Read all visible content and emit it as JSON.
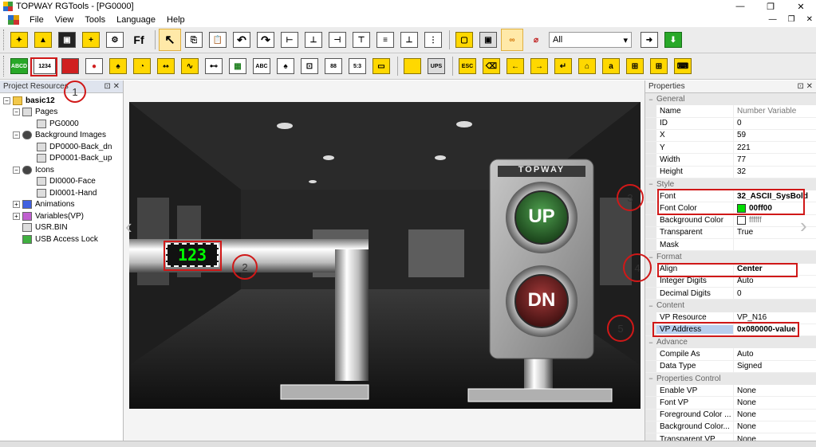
{
  "window": {
    "title": "TOPWAY RGTools - [PG0000]",
    "controls": [
      "—",
      "❐",
      "✕"
    ]
  },
  "menu": {
    "items": [
      "File",
      "View",
      "Tools",
      "Language",
      "Help"
    ],
    "mdi_controls": [
      "—",
      "❐",
      "✕"
    ]
  },
  "toolbar": {
    "layer_combo": "All",
    "icon_1234": "1234",
    "icon_abcd": "ABCD",
    "icon_ff": "Ff",
    "icon_abc": "ABC",
    "icon_esc": "ESC",
    "icon_a": "a",
    "icon_ups": "UPS"
  },
  "project_panel": {
    "title": "Project Resources",
    "tree": [
      {
        "label": "basic12",
        "level": 0
      },
      {
        "label": "Pages",
        "level": 1
      },
      {
        "label": "PG0000",
        "level": 2
      },
      {
        "label": "Background Images",
        "level": 1
      },
      {
        "label": "DP0000-Back_dn",
        "level": 2
      },
      {
        "label": "DP0001-Back_up",
        "level": 2
      },
      {
        "label": "Icons",
        "level": 1
      },
      {
        "label": "DI0000-Face",
        "level": 2
      },
      {
        "label": "DI0001-Hand",
        "level": 2
      },
      {
        "label": "Animations",
        "level": 1
      },
      {
        "label": "Variables(VP)",
        "level": 1
      },
      {
        "label": "USR.BIN",
        "level": 1
      },
      {
        "label": "USB Access Lock",
        "level": 1
      }
    ]
  },
  "canvas": {
    "number_widget": "123",
    "brand": "TOPWAY",
    "up_label": "UP",
    "dn_label": "DN"
  },
  "properties": {
    "title": "Properties",
    "rows": [
      {
        "type": "cat",
        "name": "General"
      },
      {
        "type": "row",
        "name": "Name",
        "value": "Number Variable",
        "muted": true
      },
      {
        "type": "row",
        "name": "ID",
        "value": "0"
      },
      {
        "type": "row",
        "name": "X",
        "value": "59"
      },
      {
        "type": "row",
        "name": "Y",
        "value": "221"
      },
      {
        "type": "row",
        "name": "Width",
        "value": "77"
      },
      {
        "type": "row",
        "name": "Height",
        "value": "32"
      },
      {
        "type": "cat",
        "name": "Style"
      },
      {
        "type": "row",
        "name": "Font",
        "value": "32_ASCII_SysBold",
        "bold": true
      },
      {
        "type": "row",
        "name": "Font Color",
        "value": "00ff00",
        "bold": true,
        "swatch": "#00dd00"
      },
      {
        "type": "row",
        "name": "Background Color",
        "value": "ffffff",
        "muted": true,
        "swatch": "#ffffff"
      },
      {
        "type": "row",
        "name": "Transparent",
        "value": "True"
      },
      {
        "type": "row",
        "name": "Mask",
        "value": ""
      },
      {
        "type": "cat",
        "name": "Format"
      },
      {
        "type": "row",
        "name": "Align",
        "value": "Center",
        "bold": true
      },
      {
        "type": "row",
        "name": "Integer Digits",
        "value": "Auto"
      },
      {
        "type": "row",
        "name": "Decimal Digits",
        "value": "0"
      },
      {
        "type": "cat",
        "name": "Content"
      },
      {
        "type": "row",
        "name": "VP Resource",
        "value": "VP_N16"
      },
      {
        "type": "row",
        "name": "VP Address",
        "value": "0x080000-value",
        "bold": true,
        "selected": true
      },
      {
        "type": "cat",
        "name": "Advance"
      },
      {
        "type": "row",
        "name": "Compile As",
        "value": "Auto"
      },
      {
        "type": "row",
        "name": "Data Type",
        "value": "Signed"
      },
      {
        "type": "cat",
        "name": "Properties Control"
      },
      {
        "type": "row",
        "name": "Enable VP",
        "value": "None"
      },
      {
        "type": "row",
        "name": "Font VP",
        "value": "None"
      },
      {
        "type": "row",
        "name": "Foreground Color ...",
        "value": "None"
      },
      {
        "type": "row",
        "name": "Background Color...",
        "value": "None"
      },
      {
        "type": "row",
        "name": "Transparent VP",
        "value": "None"
      }
    ]
  },
  "annotations": [
    "1",
    "2",
    "3",
    "4",
    "5"
  ]
}
